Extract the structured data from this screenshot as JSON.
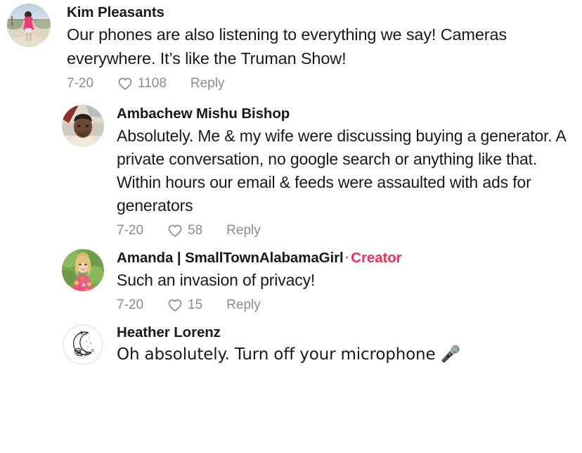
{
  "theme": {
    "background": "#ffffff",
    "text_color": "#161823",
    "muted_color": "#8a8b91",
    "creator_accent": "#fe2c55"
  },
  "comments": [
    {
      "id": "comment-kim-pleasants",
      "username": "Kim Pleasants",
      "is_creator": false,
      "creator_label": "",
      "separator": "",
      "text": "Our phones are also listening to everything we say! Cameras everywhere. It’s like the Truman Show!",
      "date": "7-20",
      "like_count": "1108",
      "reply_label": "Reply",
      "like_icon": "heart-outline-icon",
      "avatar_alt": "woman-in-pink-dress-on-beach-avatar",
      "indent": "root"
    },
    {
      "id": "comment-ambachew-mishu-bishop",
      "username": "Ambachew Mishu Bishop",
      "is_creator": false,
      "creator_label": "",
      "separator": "",
      "text": "Absolutely. Me & my wife were discussing buying a generator. A private conversation, no google search or anything like that. Within hours our email & feeds were assaulted with ads for generators",
      "date": "7-20",
      "like_count": "58",
      "reply_label": "Reply",
      "like_icon": "heart-outline-icon",
      "avatar_alt": "man-portrait-avatar",
      "indent": "reply"
    },
    {
      "id": "comment-amanda-smalltownalabamagirl",
      "username": "Amanda | SmallTownAlabamaGirl",
      "is_creator": true,
      "creator_label": "Creator",
      "separator": "·",
      "text": "Such an invasion of privacy!",
      "date": "7-20",
      "like_count": "15",
      "reply_label": "Reply",
      "like_icon": "heart-outline-icon",
      "avatar_alt": "blonde-woman-in-floral-top-avatar",
      "indent": "reply"
    },
    {
      "id": "comment-heather-lorenz",
      "username": "Heather Lorenz",
      "is_creator": false,
      "creator_label": "",
      "separator": "",
      "text": "Oh absolutely. Turn off your microphone 🎤",
      "date": "",
      "like_count": "",
      "reply_label": "",
      "like_icon": "",
      "avatar_alt": "moon-and-florals-creations-logo-avatar",
      "indent": "reply"
    }
  ]
}
